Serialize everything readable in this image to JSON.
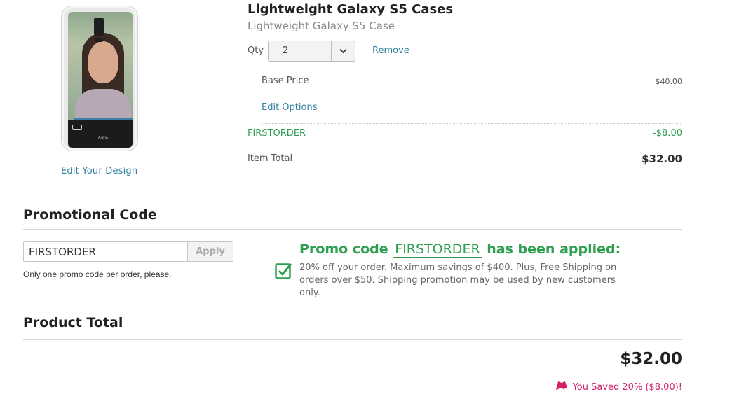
{
  "product": {
    "image_alt": "phone-case-preview",
    "brand_mark": "AsBla",
    "edit_design_label": "Edit Your Design",
    "title": "Lightweight Galaxy S5 Cases",
    "subtitle": "Lightweight Galaxy S5 Case"
  },
  "quantity": {
    "label": "Qty",
    "value": "2",
    "remove_label": "Remove"
  },
  "pricing": {
    "base_price_label": "Base Price",
    "base_price_value": "$40.00",
    "edit_options_label": "Edit Options",
    "promo_label": "FIRSTORDER",
    "promo_value": "-$8.00",
    "item_total_label": "Item Total",
    "item_total_value": "$32.00"
  },
  "promo": {
    "heading": "Promotional Code",
    "input_value": "FIRSTORDER",
    "apply_label": "Apply",
    "note": "Only one promo code per order, please.",
    "applied_prefix": "Promo code",
    "applied_code": "FIRSTORDER",
    "applied_suffix": "has been applied:",
    "applied_description": "20% off your order. Maximum savings of $400. Plus, Free Shipping on orders over $50. Shipping promotion may be used by new customers only."
  },
  "totals": {
    "heading": "Product Total",
    "grand_total": "$32.00",
    "saved_text": "You Saved 20% ($8.00)!"
  },
  "colors": {
    "link": "#2f7fa0",
    "promo_green": "#2e9e4f",
    "saved_pink": "#d2236a"
  }
}
